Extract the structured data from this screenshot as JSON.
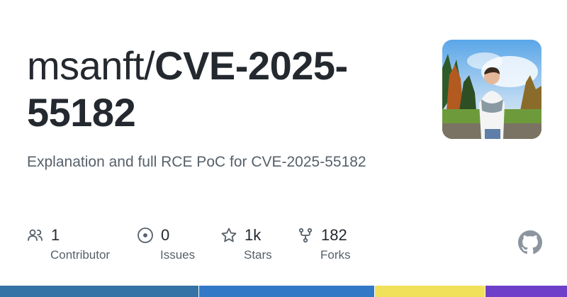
{
  "repo": {
    "owner": "msanft/",
    "name": "CVE-2025-55182",
    "description": "Explanation and full RCE PoC for CVE-2025-55182"
  },
  "stats": {
    "contributors": {
      "value": "1",
      "label": "Contributor",
      "icon": "people-icon"
    },
    "issues": {
      "value": "0",
      "label": "Issues",
      "icon": "issue-icon"
    },
    "stars": {
      "value": "1k",
      "label": "Stars",
      "icon": "star-icon"
    },
    "forks": {
      "value": "182",
      "label": "Forks",
      "icon": "fork-icon"
    }
  },
  "colors": {
    "text": "#24292f",
    "muted": "#57606a",
    "languages": [
      "#3572A5",
      "#3178c6",
      "#f1e05a",
      "#6e40c9"
    ]
  },
  "language_shares": [
    0.35,
    0.31,
    0.195,
    0.145
  ]
}
